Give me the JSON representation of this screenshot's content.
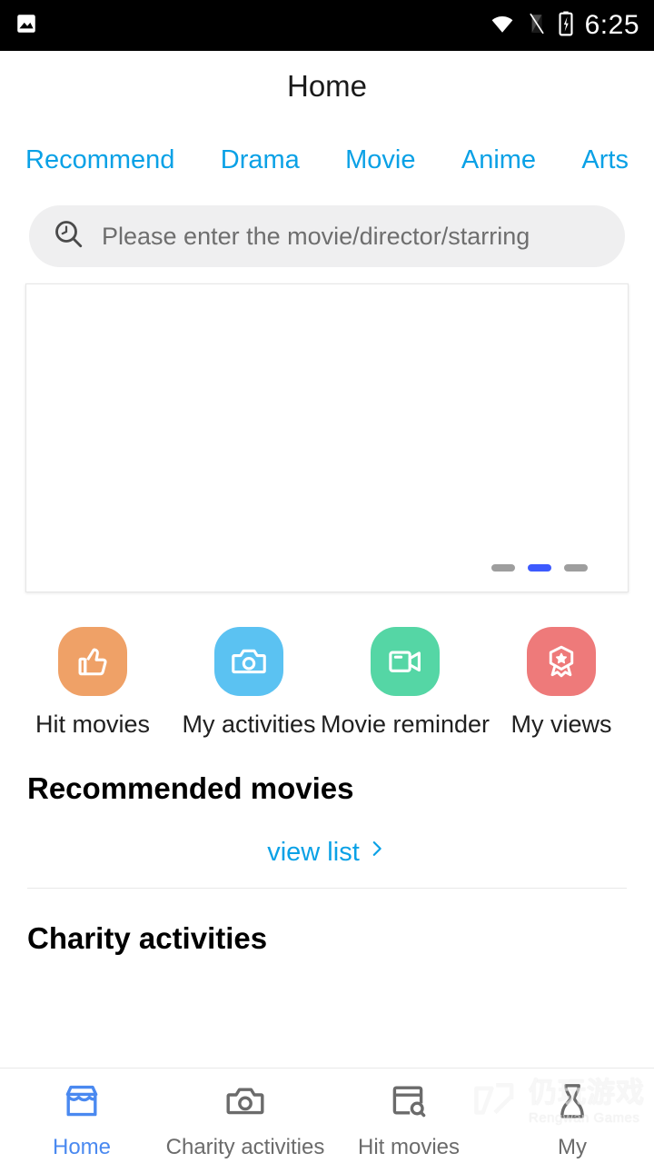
{
  "status_bar": {
    "time": "6:25",
    "icons": {
      "notification": "image-icon",
      "wifi": "wifi-icon",
      "signal": "signal-off-icon",
      "battery": "battery-charging-icon"
    }
  },
  "header": {
    "title": "Home"
  },
  "tabs": [
    {
      "label": "Recommend",
      "active": true
    },
    {
      "label": "Drama",
      "active": false
    },
    {
      "label": "Movie",
      "active": false
    },
    {
      "label": "Anime",
      "active": false
    },
    {
      "label": "Arts",
      "active": false
    }
  ],
  "search": {
    "placeholder": "Please enter the movie/director/starring",
    "value": "",
    "icon": "search-icon"
  },
  "banner": {
    "pagination": {
      "count": 3,
      "active_index": 1
    },
    "active_color": "#3d5afe",
    "inactive_color": "#9e9e9e"
  },
  "quick_actions": [
    {
      "label": "Hit movies",
      "icon": "thumbs-up-icon",
      "color": "#efa167"
    },
    {
      "label": "My activities",
      "icon": "camera-icon",
      "color": "#5bc2f2"
    },
    {
      "label": "Movie reminder",
      "icon": "video-camera-icon",
      "color": "#55d6a5"
    },
    {
      "label": "My views",
      "icon": "medal-badge-icon",
      "color": "#ee7a7a"
    }
  ],
  "sections": {
    "recommended_title": "Recommended movies",
    "view_list_label": "view list",
    "view_list_chevron": "chevron-right-icon",
    "charity_title": "Charity activities"
  },
  "bottom_nav": [
    {
      "label": "Home",
      "icon": "store-home-icon",
      "active": true
    },
    {
      "label": "Charity activities",
      "icon": "camera-icon",
      "active": false
    },
    {
      "label": "Hit movies",
      "icon": "window-search-icon",
      "active": false
    },
    {
      "label": "My",
      "icon": "person-icon",
      "active": false
    }
  ],
  "watermark": {
    "cn": "仍玩游戏",
    "en": "Rengwan Games",
    "logo": "rengwan-logo-icon"
  },
  "theme": {
    "accent_blue": "#0aa1e6",
    "nav_blue": "#4a89f0",
    "dot_blue": "#3d5afe"
  }
}
